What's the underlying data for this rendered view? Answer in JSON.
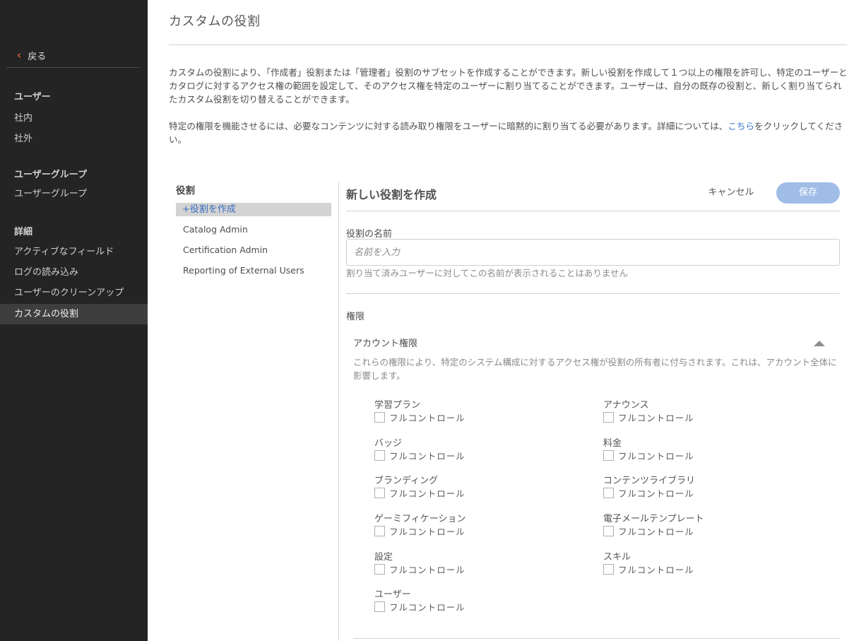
{
  "sidebar": {
    "back_label": "戻る",
    "sections": [
      {
        "heading": "ユーザー",
        "items": [
          {
            "label": "社内"
          },
          {
            "label": "社外"
          }
        ]
      },
      {
        "heading": "ユーザーグループ",
        "items": [
          {
            "label": "ユーザーグループ"
          }
        ]
      },
      {
        "heading": "詳細",
        "items": [
          {
            "label": "アクティブなフィールド"
          },
          {
            "label": "ログの読み込み"
          },
          {
            "label": "ユーザーのクリーンアップ"
          },
          {
            "label": "カスタムの役割",
            "active": true
          }
        ]
      }
    ]
  },
  "header": {
    "title": "カスタムの役割",
    "intro_1": "カスタムの役割により、「作成者」役割または「管理者」役割のサブセットを作成することができます。新しい役割を作成して１つ以上の権限を許可し、特定のユーザーとカタログに対するアクセス権の範囲を設定して、そのアクセス権を特定のユーザーに割り当てることができます。ユーザーは、自分の既存の役割と、新しく割り当てられたカスタム役割を切り替えることができます。",
    "intro_2_before": "特定の権限を機能させるには、必要なコンテンツに対する読み取り権限をユーザーに暗黙的に割り当てる必要があります。詳細については、",
    "intro_2_link": "こちら",
    "intro_2_after": "をクリックしてください。"
  },
  "roles": {
    "title": "役割",
    "create_label": "+役割を作成",
    "items": [
      "Catalog Admin",
      "Certification Admin",
      "Reporting of External Users"
    ]
  },
  "form": {
    "title": "新しい役割を作成",
    "cancel_label": "キャンセル",
    "save_label": "保存",
    "name_label": "役割の名前",
    "name_placeholder": "名前を入力",
    "name_value": "",
    "name_hint": "割り当て済みユーザーに対してこの名前が表示されることはありません",
    "permissions_label": "権限",
    "account_section": {
      "title": "アカウント権限",
      "description": "これらの権限により、特定のシステム構成に対するアクセス権が役割の所有者に付与されます。これは、アカウント全体に影響します。",
      "full_control_label": "フルコントロール",
      "left_column": [
        "学習プラン",
        "バッジ",
        "ブランディング",
        "ゲーミフィケーション",
        "設定",
        "ユーザー"
      ],
      "right_column": [
        "アナウンス",
        "料金",
        "コンテンツライブラリ",
        "電子メールテンプレート",
        "スキル"
      ]
    }
  },
  "colors": {
    "sidebar_bg": "#242424",
    "accent_link": "#3b74c9",
    "save_button": "#9fbde7",
    "back_chevron": "#e0603c"
  }
}
